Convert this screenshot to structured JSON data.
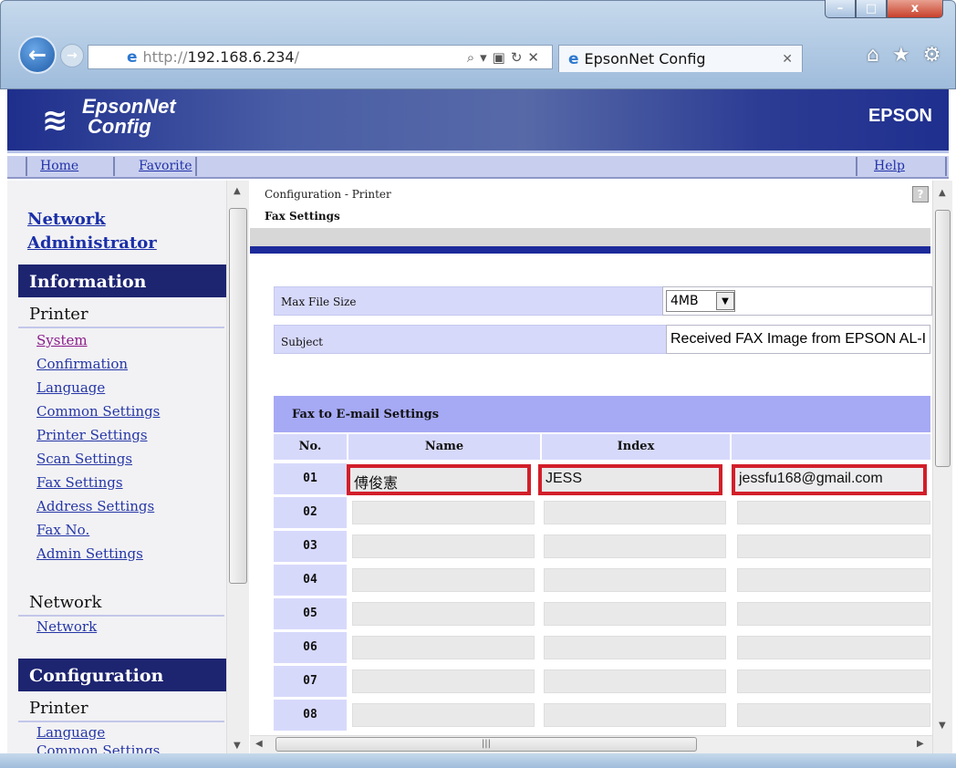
{
  "browser": {
    "url_prefix": "http://",
    "url_host": "192.168.6.234",
    "url_suffix": "/",
    "tab_title": "EpsonNet Config",
    "window_buttons": {
      "minimize": "–",
      "maximize": "□",
      "close": "x"
    }
  },
  "banner": {
    "logo_line1": "EpsonNet",
    "logo_line2": "Config",
    "brand": "EPSON"
  },
  "topnav": {
    "home": "Home",
    "favorite": "Favorite",
    "help": "Help"
  },
  "sidebar": {
    "network_admin_line1": "Network",
    "network_admin_line2": "Administrator",
    "info_header": "Information",
    "info_printer_group": "Printer",
    "info_printer_links": [
      "System",
      "Confirmation",
      "Language",
      "Common Settings",
      "Printer Settings",
      "Scan Settings",
      "Fax Settings",
      "Address Settings",
      "Fax No.",
      "Admin Settings"
    ],
    "info_network_group": "Network",
    "info_network_links": [
      "Network"
    ],
    "config_header": "Configuration",
    "config_printer_group": "Printer",
    "config_printer_links": [
      "Language",
      "Common Settings"
    ]
  },
  "main": {
    "breadcrumb": "Configuration - Printer",
    "title": "Fax Settings",
    "help_icon": "?",
    "max_file_size_label": "Max File Size",
    "max_file_size_value": "4MB",
    "subject_label": "Subject",
    "subject_value": "Received FAX Image from EPSON AL-I",
    "fax_email_header": "Fax to E-mail Settings",
    "columns": [
      "No.",
      "Name",
      "Index",
      ""
    ],
    "rows": [
      {
        "no": "01",
        "name": "傅俊憲",
        "index": "JESS",
        "email": "jessfu168@gmail.com"
      },
      {
        "no": "02",
        "name": "",
        "index": "",
        "email": ""
      },
      {
        "no": "03",
        "name": "",
        "index": "",
        "email": ""
      },
      {
        "no": "04",
        "name": "",
        "index": "",
        "email": ""
      },
      {
        "no": "05",
        "name": "",
        "index": "",
        "email": ""
      },
      {
        "no": "06",
        "name": "",
        "index": "",
        "email": ""
      },
      {
        "no": "07",
        "name": "",
        "index": "",
        "email": ""
      },
      {
        "no": "08",
        "name": "",
        "index": "",
        "email": ""
      }
    ]
  },
  "colors": {
    "banner": "#1e2e8c",
    "sidebar_header": "#1d2470",
    "table_header": "#a6a9f4",
    "highlight": "#d21f2a"
  }
}
